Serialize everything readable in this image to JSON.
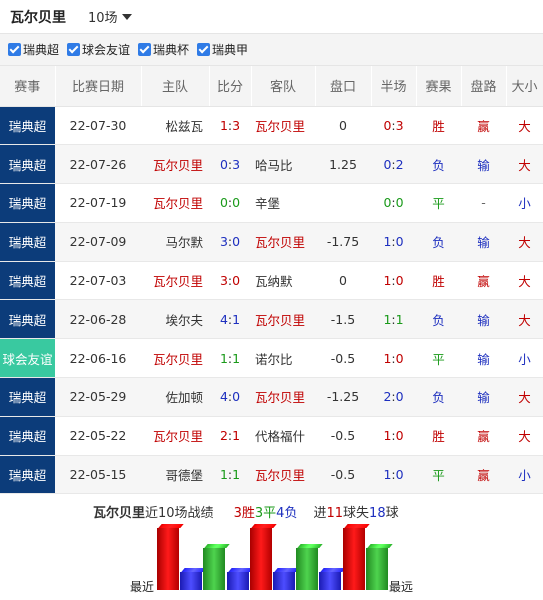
{
  "header": {
    "team": "瓦尔贝里",
    "count_label": "10场"
  },
  "filters": [
    {
      "label": "瑞典超"
    },
    {
      "label": "球会友谊"
    },
    {
      "label": "瑞典杯"
    },
    {
      "label": "瑞典甲"
    }
  ],
  "columns": [
    "赛事",
    "比赛日期",
    "主队",
    "比分",
    "客队",
    "盘口",
    "半场",
    "赛果",
    "盘路",
    "大小"
  ],
  "rows": [
    {
      "league": "瑞典超",
      "league_style": 0,
      "date": "22-07-30",
      "home": "松兹瓦",
      "home_hl": false,
      "score_h": "1",
      "score_a": "3",
      "score_color": "red",
      "away": "瓦尔贝里",
      "away_hl": true,
      "handicap": "0",
      "half_h": "0",
      "half_a": "3",
      "half_color": "red",
      "result": "胜",
      "result_color": "red",
      "cover": "赢",
      "cover_color": "red",
      "ou": "大",
      "ou_color": "red"
    },
    {
      "league": "瑞典超",
      "league_style": 0,
      "date": "22-07-26",
      "home": "瓦尔贝里",
      "home_hl": true,
      "score_h": "0",
      "score_a": "3",
      "score_color": "blue",
      "away": "哈马比",
      "away_hl": false,
      "handicap": "1.25",
      "half_h": "0",
      "half_a": "2",
      "half_color": "blue",
      "result": "负",
      "result_color": "blue",
      "cover": "输",
      "cover_color": "blue",
      "ou": "大",
      "ou_color": "red"
    },
    {
      "league": "瑞典超",
      "league_style": 0,
      "date": "22-07-19",
      "home": "瓦尔贝里",
      "home_hl": true,
      "score_h": "0",
      "score_a": "0",
      "score_color": "green",
      "away": "辛堡",
      "away_hl": false,
      "handicap": "",
      "half_h": "0",
      "half_a": "0",
      "half_color": "green",
      "result": "平",
      "result_color": "green",
      "cover": "-",
      "cover_color": "gray",
      "ou": "小",
      "ou_color": "blue"
    },
    {
      "league": "瑞典超",
      "league_style": 0,
      "date": "22-07-09",
      "home": "马尔默",
      "home_hl": false,
      "score_h": "3",
      "score_a": "0",
      "score_color": "blue",
      "away": "瓦尔贝里",
      "away_hl": true,
      "handicap": "-1.75",
      "half_h": "1",
      "half_a": "0",
      "half_color": "blue",
      "result": "负",
      "result_color": "blue",
      "cover": "输",
      "cover_color": "blue",
      "ou": "大",
      "ou_color": "red"
    },
    {
      "league": "瑞典超",
      "league_style": 0,
      "date": "22-07-03",
      "home": "瓦尔贝里",
      "home_hl": true,
      "score_h": "3",
      "score_a": "0",
      "score_color": "red",
      "away": "瓦纳默",
      "away_hl": false,
      "handicap": "0",
      "half_h": "1",
      "half_a": "0",
      "half_color": "red",
      "result": "胜",
      "result_color": "red",
      "cover": "赢",
      "cover_color": "red",
      "ou": "大",
      "ou_color": "red"
    },
    {
      "league": "瑞典超",
      "league_style": 0,
      "date": "22-06-28",
      "home": "埃尔夫",
      "home_hl": false,
      "score_h": "4",
      "score_a": "1",
      "score_color": "blue",
      "away": "瓦尔贝里",
      "away_hl": true,
      "handicap": "-1.5",
      "half_h": "1",
      "half_a": "1",
      "half_color": "green",
      "result": "负",
      "result_color": "blue",
      "cover": "输",
      "cover_color": "blue",
      "ou": "大",
      "ou_color": "red"
    },
    {
      "league": "球会友谊",
      "league_style": 1,
      "date": "22-06-16",
      "home": "瓦尔贝里",
      "home_hl": true,
      "score_h": "1",
      "score_a": "1",
      "score_color": "green",
      "away": "诺尔比",
      "away_hl": false,
      "handicap": "-0.5",
      "half_h": "1",
      "half_a": "0",
      "half_color": "red",
      "result": "平",
      "result_color": "green",
      "cover": "输",
      "cover_color": "blue",
      "ou": "小",
      "ou_color": "blue"
    },
    {
      "league": "瑞典超",
      "league_style": 0,
      "date": "22-05-29",
      "home": "佐加顿",
      "home_hl": false,
      "score_h": "4",
      "score_a": "0",
      "score_color": "blue",
      "away": "瓦尔贝里",
      "away_hl": true,
      "handicap": "-1.25",
      "half_h": "2",
      "half_a": "0",
      "half_color": "blue",
      "result": "负",
      "result_color": "blue",
      "cover": "输",
      "cover_color": "blue",
      "ou": "大",
      "ou_color": "red"
    },
    {
      "league": "瑞典超",
      "league_style": 0,
      "date": "22-05-22",
      "home": "瓦尔贝里",
      "home_hl": true,
      "score_h": "2",
      "score_a": "1",
      "score_color": "red",
      "away": "代格福什",
      "away_hl": false,
      "handicap": "-0.5",
      "half_h": "1",
      "half_a": "0",
      "half_color": "red",
      "result": "胜",
      "result_color": "red",
      "cover": "赢",
      "cover_color": "red",
      "ou": "大",
      "ou_color": "red"
    },
    {
      "league": "瑞典超",
      "league_style": 0,
      "date": "22-05-15",
      "home": "哥德堡",
      "home_hl": false,
      "score_h": "1",
      "score_a": "1",
      "score_color": "green",
      "away": "瓦尔贝里",
      "away_hl": true,
      "handicap": "-0.5",
      "half_h": "1",
      "half_a": "0",
      "half_color": "blue",
      "result": "平",
      "result_color": "green",
      "cover": "赢",
      "cover_color": "red",
      "ou": "小",
      "ou_color": "blue"
    }
  ],
  "summary": {
    "team": "瓦尔贝里",
    "recent_label": "近10场战绩",
    "wins": "3",
    "win_suffix": "胜",
    "draws": "3",
    "draw_suffix": "平",
    "losses": "4",
    "loss_suffix": "负",
    "scored_prefix": "进",
    "scored": "11",
    "scored_suffix": "球",
    "conceded_prefix": "失",
    "conceded": "18",
    "conceded_suffix": "球"
  },
  "chart_data": {
    "type": "bar",
    "categories": [
      "1",
      "2",
      "3",
      "4",
      "5",
      "6",
      "7",
      "8",
      "9",
      "10"
    ],
    "results": [
      "胜",
      "负",
      "平",
      "负",
      "胜",
      "负",
      "平",
      "负",
      "胜",
      "平"
    ],
    "left_label": "最近",
    "right_label": "最远"
  },
  "colors": {
    "win": "#e60000",
    "draw": "#33bb33",
    "loss": "#2222dd",
    "league_main": "#0c3c7a",
    "league_friendly": "#39c9a0"
  }
}
